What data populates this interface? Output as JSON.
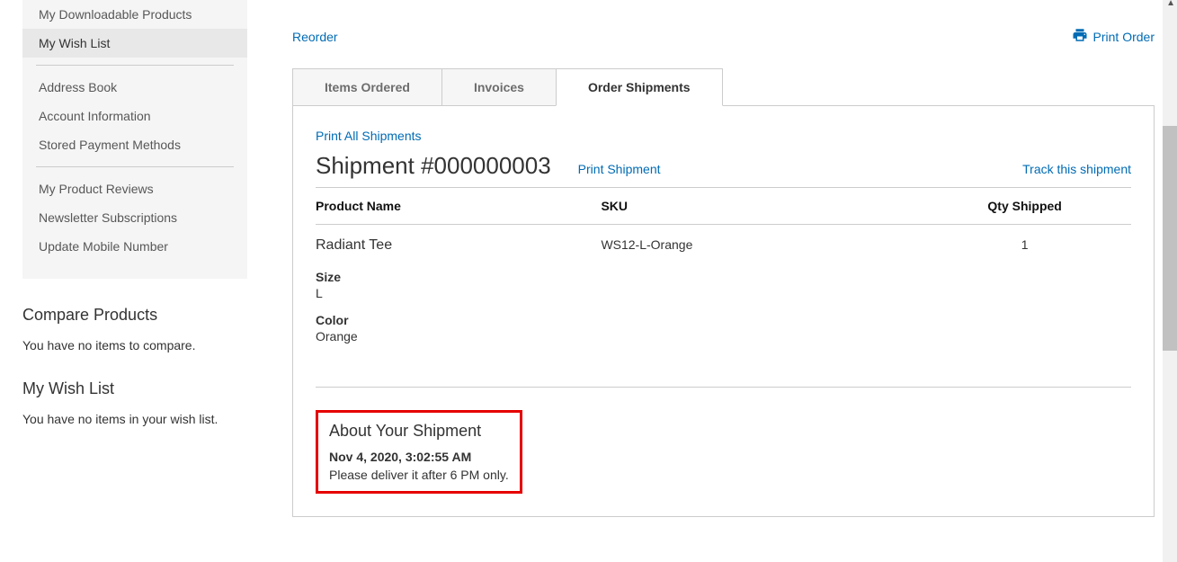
{
  "sidebar": {
    "items": [
      {
        "label": "My Downloadable Products",
        "active": false
      },
      {
        "label": "My Wish List",
        "active": true
      },
      {
        "label": "Address Book",
        "active": false
      },
      {
        "label": "Account Information",
        "active": false
      },
      {
        "label": "Stored Payment Methods",
        "active": false
      },
      {
        "label": "My Product Reviews",
        "active": false
      },
      {
        "label": "Newsletter Subscriptions",
        "active": false
      },
      {
        "label": "Update Mobile Number",
        "active": false
      }
    ]
  },
  "compare": {
    "title": "Compare Products",
    "empty": "You have no items to compare."
  },
  "wishlist": {
    "title": "My Wish List",
    "empty": "You have no items in your wish list."
  },
  "actions": {
    "reorder": "Reorder",
    "print_order": "Print Order"
  },
  "tabs": {
    "items_ordered": "Items Ordered",
    "invoices": "Invoices",
    "order_shipments": "Order Shipments"
  },
  "shipment": {
    "print_all": "Print All Shipments",
    "title": "Shipment #000000003",
    "print_shipment": "Print Shipment",
    "track": "Track this shipment",
    "columns": {
      "product": "Product Name",
      "sku": "SKU",
      "qty": "Qty Shipped"
    },
    "rows": [
      {
        "product": "Radiant Tee",
        "sku": "WS12-L-Orange",
        "qty": "1",
        "options": [
          {
            "label": "Size",
            "value": "L"
          },
          {
            "label": "Color",
            "value": "Orange"
          }
        ]
      }
    ],
    "about": {
      "title": "About Your Shipment",
      "date": "Nov 4, 2020, 3:02:55 AM",
      "message": "Please deliver it after 6 PM only."
    }
  }
}
